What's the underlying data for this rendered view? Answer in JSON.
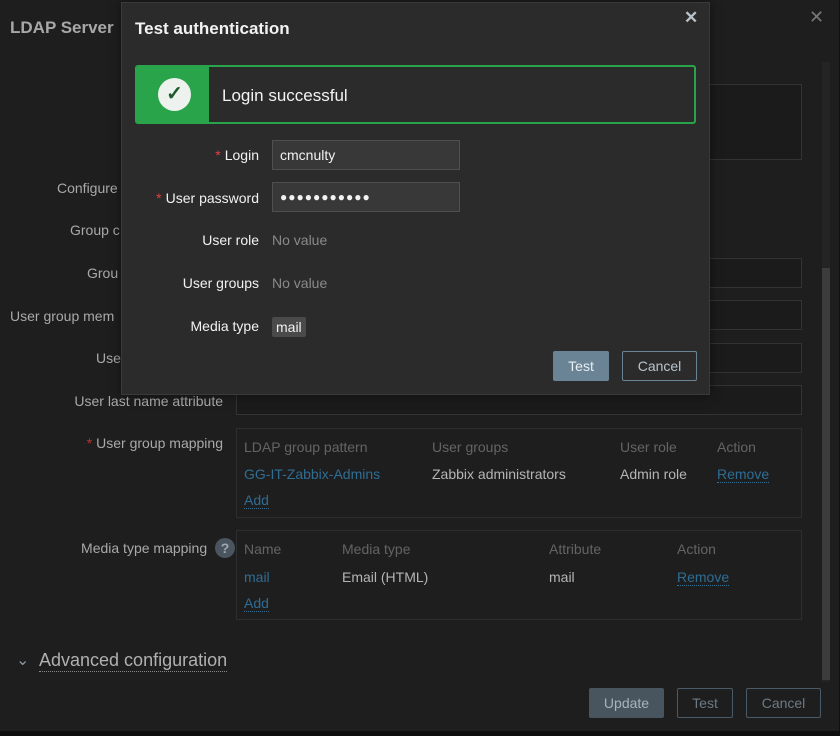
{
  "background_dialog": {
    "title": "LDAP Server",
    "close_icon": "close-icon",
    "labels": {
      "configured": "Configure",
      "group_c": "Group c",
      "group": "Grou",
      "user_group_mem": "User group mem",
      "user": "Use",
      "last_name": "User last name attribute",
      "user_group_mapping": "User group mapping",
      "media_type_mapping": "Media type mapping"
    },
    "required_mark": "*",
    "help_icon": "?",
    "user_group_mapping": {
      "headers": [
        "LDAP group pattern",
        "User groups",
        "User role",
        "Action"
      ],
      "rows": [
        {
          "pattern": "GG-IT-Zabbix-Admins",
          "groups": "Zabbix administrators",
          "role": "Admin role",
          "action": "Remove"
        }
      ],
      "add": "Add"
    },
    "media_type_mapping": {
      "headers": [
        "Name",
        "Media type",
        "Attribute",
        "Action"
      ],
      "rows": [
        {
          "name": "mail",
          "media_type": "Email (HTML)",
          "attribute": "mail",
          "action": "Remove"
        }
      ],
      "add": "Add"
    },
    "advanced": "Advanced configuration",
    "buttons": {
      "update": "Update",
      "test": "Test",
      "cancel": "Cancel"
    }
  },
  "modal": {
    "title": "Test authentication",
    "close": "✕",
    "message": "Login successful",
    "success_color": "#2aa44a",
    "fields": {
      "login_label": "Login",
      "login_value": "cmcnulty",
      "password_label": "User password",
      "password_value": "●●●●●●●●●●●",
      "role_label": "User role",
      "role_value": "No value",
      "groups_label": "User groups",
      "groups_value": "No value",
      "media_label": "Media type",
      "media_value": "mail"
    },
    "buttons": {
      "test": "Test",
      "cancel": "Cancel"
    }
  }
}
